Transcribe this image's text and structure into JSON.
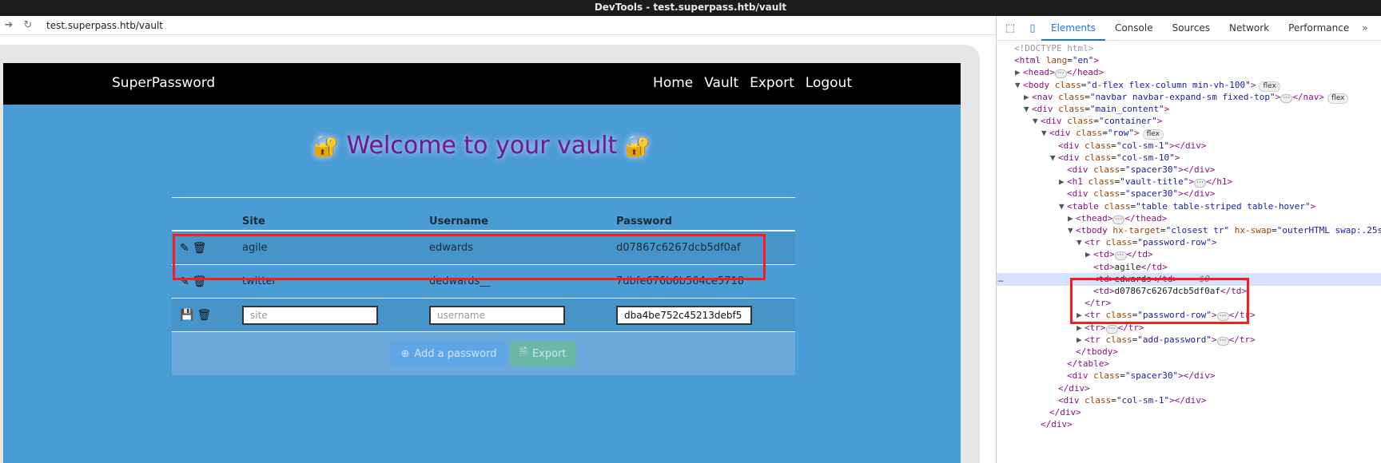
{
  "window": {
    "title": "DevTools - test.superpass.htb/vault"
  },
  "browser": {
    "url": "test.superpass.htb/vault"
  },
  "site": {
    "brand": "SuperPassword",
    "nav": [
      "Home",
      "Vault",
      "Export",
      "Logout"
    ],
    "vault_title": "Welcome to your vault",
    "title_emoji": "🔐",
    "table": {
      "headers": [
        "Site",
        "Username",
        "Password"
      ],
      "rows": [
        {
          "site": "agile",
          "username": "edwards",
          "password": "d07867c6267dcb5df0af"
        },
        {
          "site": "twitter",
          "username": "dedwards__",
          "password": "7dbfe676b6b564ce5718"
        }
      ],
      "add_row": {
        "site_placeholder": "site",
        "username_placeholder": "username",
        "password_value": "dba4be752c45213debf5"
      }
    },
    "buttons": {
      "add": "Add a password",
      "export": "Export"
    },
    "icons": {
      "edit": "edit-icon",
      "delete": "trash-icon",
      "save": "save-icon",
      "plus": "plus-circle-icon",
      "file": "file-export-icon"
    }
  },
  "devtools": {
    "tabs": [
      "Elements",
      "Console",
      "Sources",
      "Network",
      "Performance"
    ],
    "active_tab": "Elements",
    "dom_lines": [
      {
        "indent": 0,
        "tri": "",
        "html": "<span class='muted'>&lt;!DOCTYPE html&gt;</span>"
      },
      {
        "indent": 0,
        "tri": "",
        "html": "<span class='tag'>&lt;html</span> <span class='attr'>lang</span>=<span class='val'>\"en\"</span><span class='tag'>&gt;</span>"
      },
      {
        "indent": 1,
        "tri": "▶",
        "html": "<span class='tag'>&lt;head&gt;</span><span class='dots'>⋯</span><span class='tag'>&lt;/head&gt;</span>"
      },
      {
        "indent": 1,
        "tri": "▼",
        "html": "<span class='tag'>&lt;body</span> <span class='attr'>class</span>=<span class='val'>\"d-flex flex-column min-vh-100\"</span><span class='tag'>&gt;</span><span class='pill'>flex</span>"
      },
      {
        "indent": 2,
        "tri": "▶",
        "html": "<span class='tag'>&lt;nav</span> <span class='attr'>class</span>=<span class='val'>\"navbar navbar-expand-sm fixed-top\"</span><span class='tag'>&gt;</span><span class='dots'>⋯</span><span class='tag'>&lt;/nav&gt;</span><span class='pill'>flex</span>"
      },
      {
        "indent": 2,
        "tri": "▼",
        "html": "<span class='tag'>&lt;div</span> <span class='attr'>class</span>=<span class='val'>\"main_content\"</span><span class='tag'>&gt;</span>"
      },
      {
        "indent": 3,
        "tri": "▼",
        "html": "<span class='tag'>&lt;div</span> <span class='attr'>class</span>=<span class='val'>\"container\"</span><span class='tag'>&gt;</span>"
      },
      {
        "indent": 4,
        "tri": "▼",
        "html": "<span class='tag'>&lt;div</span> <span class='attr'>class</span>=<span class='val'>\"row\"</span><span class='tag'>&gt;</span><span class='pill'>flex</span>"
      },
      {
        "indent": 5,
        "tri": "",
        "html": "<span class='tag'>&lt;div</span> <span class='attr'>class</span>=<span class='val'>\"col-sm-1\"</span><span class='tag'>&gt;&lt;/div&gt;</span>"
      },
      {
        "indent": 5,
        "tri": "▼",
        "html": "<span class='tag'>&lt;div</span> <span class='attr'>class</span>=<span class='val'>\"col-sm-10\"</span><span class='tag'>&gt;</span>"
      },
      {
        "indent": 6,
        "tri": "",
        "html": "<span class='tag'>&lt;div</span> <span class='attr'>class</span>=<span class='val'>\"spacer30\"</span><span class='tag'>&gt;&lt;/div&gt;</span>"
      },
      {
        "indent": 6,
        "tri": "▶",
        "html": "<span class='tag'>&lt;h1</span> <span class='attr'>class</span>=<span class='val'>\"vault-title\"</span><span class='tag'>&gt;</span><span class='dots'>⋯</span><span class='tag'>&lt;/h1&gt;</span>"
      },
      {
        "indent": 6,
        "tri": "",
        "html": "<span class='tag'>&lt;div</span> <span class='attr'>class</span>=<span class='val'>\"spacer30\"</span><span class='tag'>&gt;&lt;/div&gt;</span>"
      },
      {
        "indent": 6,
        "tri": "▼",
        "html": "<span class='tag'>&lt;table</span> <span class='attr'>class</span>=<span class='val'>\"table table-striped table-hover\"</span><span class='tag'>&gt;</span>"
      },
      {
        "indent": 7,
        "tri": "▶",
        "html": "<span class='tag'>&lt;thead&gt;</span><span class='dots'>⋯</span><span class='tag'>&lt;/thead&gt;</span>"
      },
      {
        "indent": 7,
        "tri": "▼",
        "html": "<span class='tag'>&lt;tbody</span> <span class='attr'>hx-target</span>=<span class='val'>\"closest tr\"</span> <span class='attr'>hx-swap</span>=<span class='val'>\"outerHTML swap:.25s</span>"
      },
      {
        "indent": 8,
        "tri": "▼",
        "html": "<span class='tag'>&lt;tr</span> <span class='attr'>class</span>=<span class='val'>\"password-row\"</span><span class='tag'>&gt;</span>"
      },
      {
        "indent": 9,
        "tri": "▶",
        "html": "<span class='tag'>&lt;td&gt;</span><span class='dots'>⋯</span><span class='tag'>&lt;/td&gt;</span>"
      },
      {
        "indent": 9,
        "tri": "",
        "html": "<span class='tag'>&lt;td&gt;</span><span class='txt'>agile</span><span class='tag'>&lt;/td&gt;</span>"
      },
      {
        "indent": 9,
        "tri": "",
        "sel": true,
        "html": "<span class='tag'>&lt;td&gt;</span><span class='txt'>edwards</span><span class='tag'>&lt;/td&gt;</span> <span class='eq'>== $0</span>"
      },
      {
        "indent": 9,
        "tri": "",
        "html": "<span class='tag'>&lt;td&gt;</span><span class='txt'>d07867c6267dcb5df0af</span><span class='tag'>&lt;/td&gt;</span>"
      },
      {
        "indent": 8,
        "tri": "",
        "html": "<span class='tag'>&lt;/tr&gt;</span>"
      },
      {
        "indent": 8,
        "tri": "▶",
        "html": "<span class='tag'>&lt;tr</span> <span class='attr'>class</span>=<span class='val'>\"password-row\"</span><span class='tag'>&gt;</span><span class='dots'>⋯</span><span class='tag'>&lt;/tr&gt;</span>"
      },
      {
        "indent": 8,
        "tri": "▶",
        "html": "<span class='tag'>&lt;tr&gt;</span><span class='dots'>⋯</span><span class='tag'>&lt;/tr&gt;</span>"
      },
      {
        "indent": 8,
        "tri": "▶",
        "html": "<span class='tag'>&lt;tr</span> <span class='attr'>class</span>=<span class='val'>\"add-password\"</span><span class='tag'>&gt;</span><span class='dots'>⋯</span><span class='tag'>&lt;/tr&gt;</span>"
      },
      {
        "indent": 7,
        "tri": "",
        "html": "<span class='tag'>&lt;/tbody&gt;</span>"
      },
      {
        "indent": 6,
        "tri": "",
        "html": "<span class='tag'>&lt;/table&gt;</span>"
      },
      {
        "indent": 6,
        "tri": "",
        "html": "<span class='tag'>&lt;div</span> <span class='attr'>class</span>=<span class='val'>\"spacer30\"</span><span class='tag'>&gt;&lt;/div&gt;</span>"
      },
      {
        "indent": 5,
        "tri": "",
        "html": "<span class='tag'>&lt;/div&gt;</span>"
      },
      {
        "indent": 5,
        "tri": "",
        "html": "<span class='tag'>&lt;div</span> <span class='attr'>class</span>=<span class='val'>\"col-sm-1\"</span><span class='tag'>&gt;&lt;/div&gt;</span>"
      },
      {
        "indent": 4,
        "tri": "",
        "html": "<span class='tag'>&lt;/div&gt;</span>"
      },
      {
        "indent": 3,
        "tri": "",
        "html": "<span class='tag'>&lt;/div&gt;</span>"
      }
    ]
  }
}
